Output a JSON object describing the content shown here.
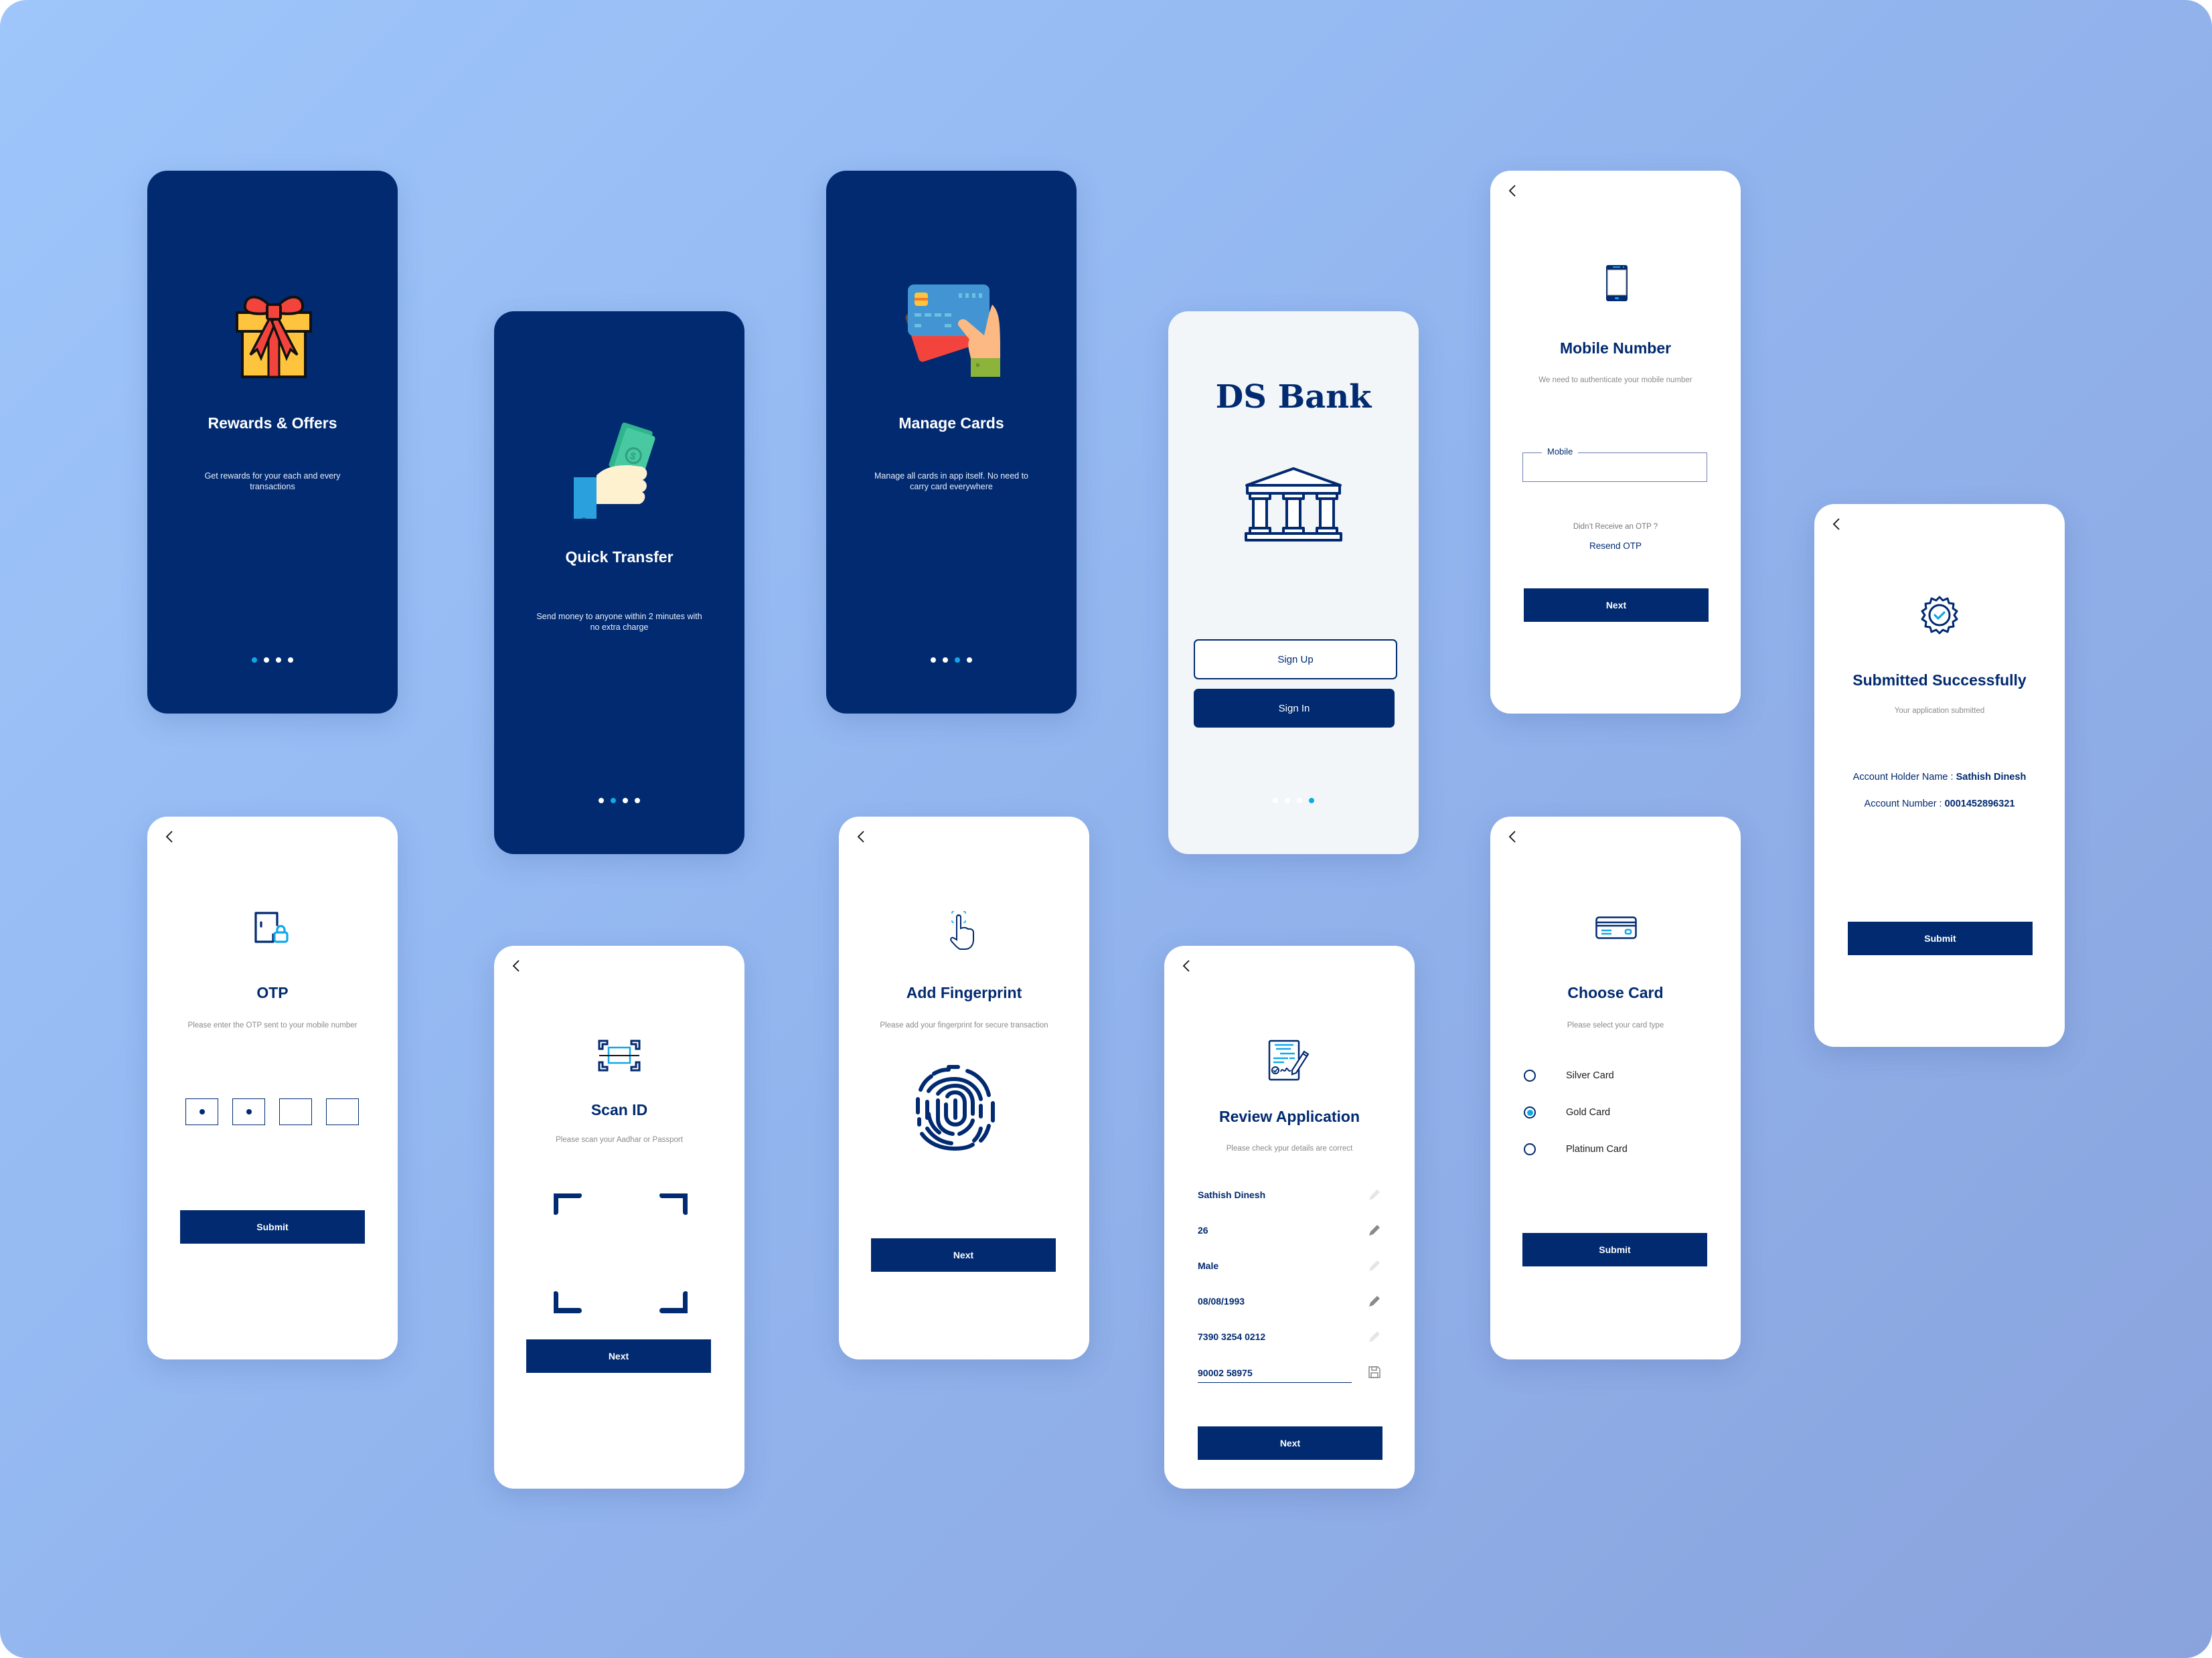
{
  "colors": {
    "primary": "#012a70",
    "accent": "#11a8ea",
    "muted_text": "#8a8a8a"
  },
  "onboarding": [
    {
      "title": "Rewards & Offers",
      "description": "Get rewards for your each and every transactions",
      "illustration": "gift-box",
      "active_dot": 0
    },
    {
      "title": "Quick Transfer",
      "description": "Send money to anyone within 2 minutes with no extra charge",
      "illustration": "hand-with-money",
      "active_dot": 1
    },
    {
      "title": "Manage Cards",
      "description": "Manage all cards in app itself. No need to carry card everywhere",
      "illustration": "hand-with-cards",
      "active_dot": 2
    }
  ],
  "welcome": {
    "brand": "DS Bank",
    "illustration": "bank-building",
    "sign_up_label": "Sign Up",
    "sign_in_label": "Sign In",
    "active_dot": 3
  },
  "mobile_number": {
    "title": "Mobile Number",
    "subtitle": "We need to authenticate your mobile number",
    "field_label": "Mobile",
    "field_value": "",
    "otp_prompt": "Didn’t Receive an OTP ?",
    "resend_label": "Resend OTP",
    "next_label": "Next"
  },
  "submitted": {
    "title": "Submitted Successfully",
    "subtitle": "Your application submitted",
    "holder_label": "Account Holder Name : ",
    "holder_value": "Sathish Dinesh",
    "account_label": "Account Number : ",
    "account_value": "0001452896321",
    "submit_label": "Submit"
  },
  "otp": {
    "title": "OTP",
    "subtitle": "Please enter the OTP sent to your mobile number",
    "digits_filled": 2,
    "digits_total": 4,
    "submit_label": "Submit"
  },
  "scan_id": {
    "title": "Scan ID",
    "subtitle": "Please scan your Aadhar or Passport",
    "next_label": "Next"
  },
  "fingerprint": {
    "title": "Add Fingerprint",
    "subtitle": "Please add your fingerprint for secure transaction",
    "next_label": "Next"
  },
  "review": {
    "title": "Review Application",
    "subtitle": "Please check ypur details are correct",
    "rows": [
      {
        "value": "Sathish Dinesh",
        "action_icon": "pencil-icon",
        "icon_state": "faded"
      },
      {
        "value": "26",
        "action_icon": "pencil-icon",
        "icon_state": "active"
      },
      {
        "value": "Male",
        "action_icon": "pencil-icon",
        "icon_state": "faded"
      },
      {
        "value": "08/08/1993",
        "action_icon": "pencil-icon",
        "icon_state": "active"
      },
      {
        "value": "7390 3254 0212",
        "action_icon": "pencil-icon",
        "icon_state": "faded"
      },
      {
        "value": "90002 58975",
        "action_icon": "save-icon",
        "icon_state": "editing"
      }
    ],
    "next_label": "Next"
  },
  "choose_card": {
    "title": "Choose Card",
    "subtitle": "Please select your card type",
    "options": [
      {
        "label": "Silver Card",
        "selected": false
      },
      {
        "label": "Gold Card",
        "selected": true
      },
      {
        "label": "Platinum Card",
        "selected": false
      }
    ],
    "submit_label": "Submit"
  }
}
